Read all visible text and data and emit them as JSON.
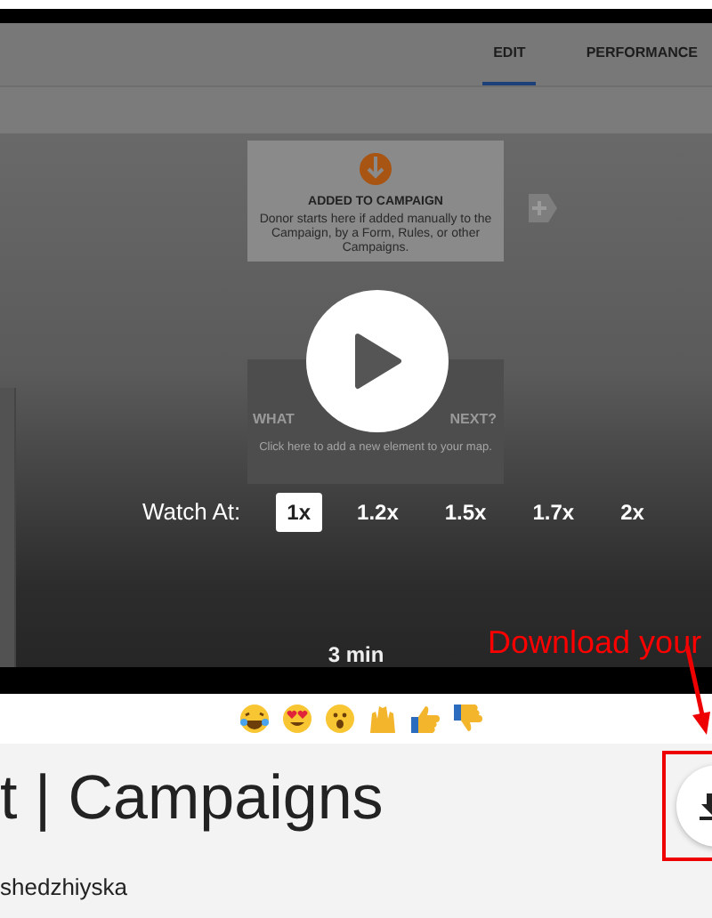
{
  "app_screen": {
    "tabs": [
      {
        "label": "EDIT",
        "selected": true
      },
      {
        "label": "PERFORMANCE",
        "selected": false
      }
    ],
    "start_card": {
      "title": "ADDED TO CAMPAIGN",
      "text": "Donor starts here if added manually to the Campaign, by a Form, Rules, or other Campaigns."
    },
    "next_card": {
      "title_parts": [
        "WHAT",
        "NEXT?"
      ],
      "text": "Click here to add a new element to your map."
    }
  },
  "player": {
    "watch_at_label": "Watch At:",
    "speeds": [
      {
        "label": "1x",
        "selected": true
      },
      {
        "label": "1.2x",
        "selected": false
      },
      {
        "label": "1.5x",
        "selected": false
      },
      {
        "label": "1.7x",
        "selected": false
      },
      {
        "label": "2x",
        "selected": false
      }
    ],
    "duration": "3 min"
  },
  "annotation": {
    "text": "Download your"
  },
  "video": {
    "title": "t | Campaigns",
    "author": "shedzhiyska"
  }
}
